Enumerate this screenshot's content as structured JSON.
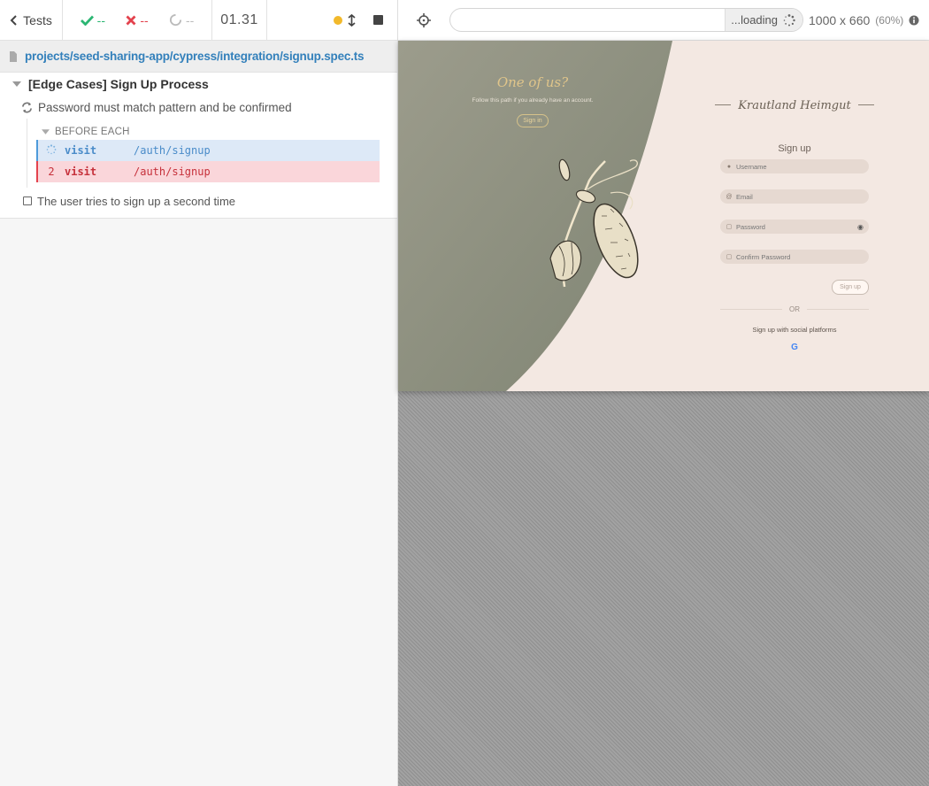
{
  "reporter": {
    "tests_label": "Tests",
    "stats": {
      "passed": "--",
      "failed": "--",
      "pending": "--"
    },
    "duration": "01.31",
    "spec_path": "projects/seed-sharing-app/cypress/integration/signup.spec.ts",
    "suite_title": "[Edge Cases] Sign Up Process",
    "test_1_title": "Password must match pattern and be confirmed",
    "hook_title": "BEFORE EACH",
    "commands": [
      {
        "num": "",
        "name": "visit",
        "message": "/auth/signup",
        "state": "running"
      },
      {
        "num": "2",
        "name": "visit",
        "message": "/auth/signup",
        "state": "failed"
      }
    ],
    "test_2_title": "The user tries to sign up a second time"
  },
  "aut_header": {
    "url_value": "",
    "loading_label": "...loading",
    "viewport": "1000 x 660",
    "scale": "(60%)"
  },
  "app": {
    "welcome_title": "One of us?",
    "welcome_sub": "Follow this path if you already have an account.",
    "signin_label": "Sign in",
    "brand": "Krautland Heimgut",
    "form_title": "Sign up",
    "fields": {
      "username_placeholder": "Username",
      "email_placeholder": "Email",
      "password_placeholder": "Password",
      "confirm_placeholder": "Confirm Password"
    },
    "signup_label": "Sign up",
    "or_label": "OR",
    "social_label": "Sign up with social platforms",
    "google_glyph": "G"
  },
  "colors": {
    "pass": "#2bb673",
    "fail": "#e3424d",
    "running": "#4e9ada",
    "link": "#3380bb",
    "sage": "#8c8f80",
    "cream": "#f3e8e2"
  }
}
